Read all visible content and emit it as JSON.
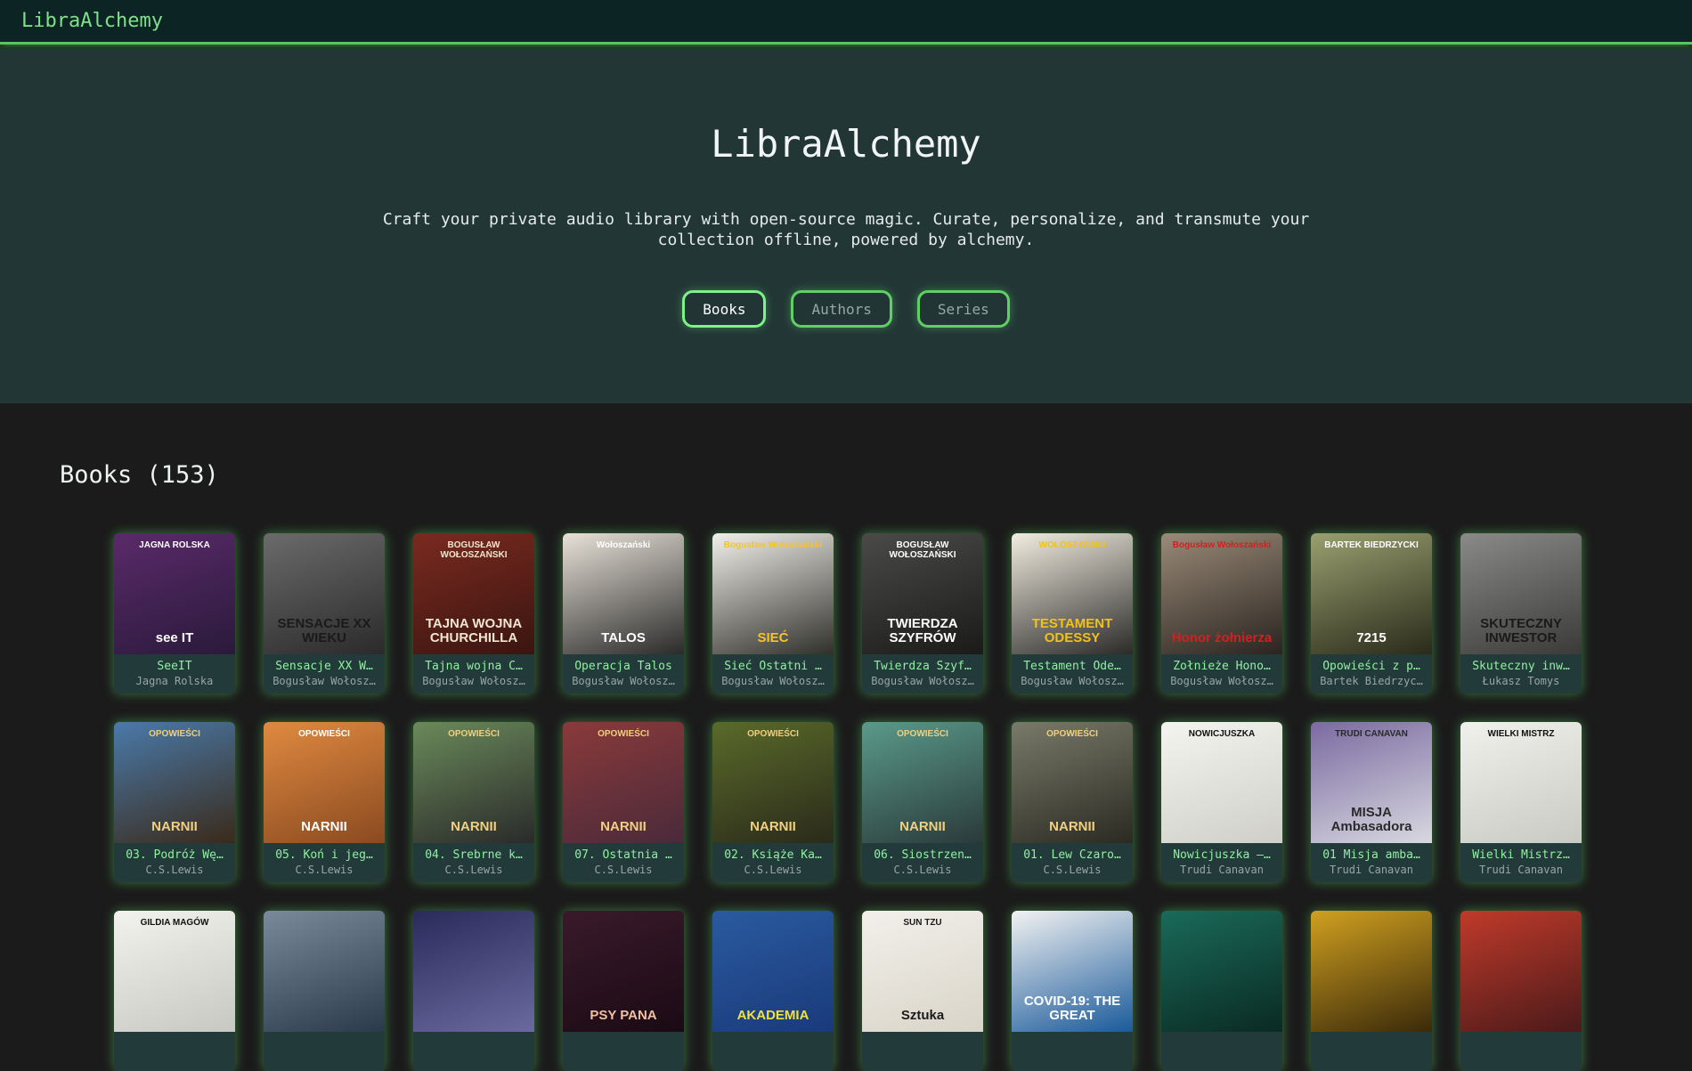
{
  "nav": {
    "brand": "LibraAlchemy"
  },
  "hero": {
    "title": "LibraAlchemy",
    "tagline": "Craft your private audio library with open-source magic. Curate, personalize, and transmute your collection offline, powered by alchemy.",
    "tabs": [
      {
        "label": "Books",
        "active": true
      },
      {
        "label": "Authors",
        "active": false
      },
      {
        "label": "Series",
        "active": false
      }
    ]
  },
  "books_section": {
    "heading": "Books (153)"
  },
  "books": [
    {
      "title": "SeeIT",
      "author": "Jagna Rolska",
      "cover_text": "see IT",
      "cover_author": "JAGNA ROLSKA",
      "cover_bg": "#5a2a6a",
      "cover_bg2": "#2a1a3a",
      "cover_fg": "#ffffff"
    },
    {
      "title": "Sensacje XX W…",
      "author": "Bogusław Wołosz…",
      "cover_text": "SENSACJE XX WIEKU",
      "cover_author": "",
      "cover_bg": "#6b6b6b",
      "cover_bg2": "#2a2a2a",
      "cover_fg": "#1a1a1a"
    },
    {
      "title": "Tajna wojna C…",
      "author": "Bogusław Wołosz…",
      "cover_text": "TAJNA WOJNA CHURCHILLA",
      "cover_author": "BOGUSŁAW WOŁOSZAŃSKI",
      "cover_bg": "#7a2a20",
      "cover_bg2": "#3a1510",
      "cover_fg": "#f0e6d0"
    },
    {
      "title": "Operacja Talos",
      "author": "Bogusław Wołosz…",
      "cover_text": "TALOS",
      "cover_author": "Wołoszański",
      "cover_bg": "#e8e2d8",
      "cover_bg2": "#2a2a2a",
      "cover_fg": "#ffffff"
    },
    {
      "title": "Sieć Ostatni …",
      "author": "Bogusław Wołosz…",
      "cover_text": "SIEĆ",
      "cover_author": "Bogusław Wołoszański",
      "cover_bg": "#f2f0ea",
      "cover_bg2": "#30302a",
      "cover_fg": "#f3c52a"
    },
    {
      "title": "Twierdza Szyf…",
      "author": "Bogusław Wołosz…",
      "cover_text": "TWIERDZA SZYFRÓW",
      "cover_author": "BOGUSŁAW WOŁOSZAŃSKI",
      "cover_bg": "#4a4a48",
      "cover_bg2": "#1a1a18",
      "cover_fg": "#ffffff"
    },
    {
      "title": "Testament Ode…",
      "author": "Bogusław Wołosz…",
      "cover_text": "TESTAMENT ODESSY",
      "cover_author": "WOŁOSZAŃSKI",
      "cover_bg": "#f2ede0",
      "cover_bg2": "#2a2a28",
      "cover_fg": "#f0c21a"
    },
    {
      "title": "Żołnieże Hono…",
      "author": "Bogusław Wołosz…",
      "cover_text": "Honor żołnierza",
      "cover_author": "Bogusław Wołoszański",
      "cover_bg": "#9a8a78",
      "cover_bg2": "#2a2420",
      "cover_fg": "#d22020"
    },
    {
      "title": "Opowieści z p…",
      "author": "Bartek Biedrzyc…",
      "cover_text": "7215",
      "cover_author": "BARTEK BIEDRZYCKI",
      "cover_bg": "#9aa070",
      "cover_bg2": "#2a2a1a",
      "cover_fg": "#ffffff"
    },
    {
      "title": "Skuteczny inw…",
      "author": "Łukasz Tomys",
      "cover_text": "SKUTECZNY INWESTOR",
      "cover_author": "",
      "cover_bg": "#8a8a88",
      "cover_bg2": "#3a3a38",
      "cover_fg": "#1a1a1a"
    },
    {
      "title": "03. Podróż Wę…",
      "author": "C.S.Lewis",
      "cover_text": "NARNII",
      "cover_author": "OPOWIEŚCI",
      "cover_bg": "#4a7aaa",
      "cover_bg2": "#3a2a1a",
      "cover_fg": "#f0d080"
    },
    {
      "title": "05. Koń i jeg…",
      "author": "C.S.Lewis",
      "cover_text": "NARNII",
      "cover_author": "OPOWIEŚCI",
      "cover_bg": "#e08a40",
      "cover_bg2": "#8a4a20",
      "cover_fg": "#ffffff"
    },
    {
      "title": "04. Srebrne k…",
      "author": "C.S.Lewis",
      "cover_text": "NARNII",
      "cover_author": "OPOWIEŚCI",
      "cover_bg": "#6a8a5a",
      "cover_bg2": "#2a2a2a",
      "cover_fg": "#f0d080"
    },
    {
      "title": "07. Ostatnia …",
      "author": "C.S.Lewis",
      "cover_text": "NARNII",
      "cover_author": "OPOWIEŚCI",
      "cover_bg": "#8a3a3a",
      "cover_bg2": "#4a2a3a",
      "cover_fg": "#f0d080"
    },
    {
      "title": "02. Książe Ka…",
      "author": "C.S.Lewis",
      "cover_text": "NARNII",
      "cover_author": "OPOWIEŚCI",
      "cover_bg": "#5a6a2a",
      "cover_bg2": "#2a2a1a",
      "cover_fg": "#f0d080"
    },
    {
      "title": "06. Siostrzen…",
      "author": "C.S.Lewis",
      "cover_text": "NARNII",
      "cover_author": "OPOWIEŚCI",
      "cover_bg": "#5a9a8a",
      "cover_bg2": "#2a3a3a",
      "cover_fg": "#f0d080"
    },
    {
      "title": "01. Lew Czaro…",
      "author": "C.S.Lewis",
      "cover_text": "NARNII",
      "cover_author": "OPOWIEŚCI",
      "cover_bg": "#7a7a6a",
      "cover_bg2": "#2a2a22",
      "cover_fg": "#f0d080"
    },
    {
      "title": "Nowicjuszka –…",
      "author": "Trudi Canavan",
      "cover_text": "",
      "cover_author": "NOWICJUSZKA",
      "cover_bg": "#f4f4f0",
      "cover_bg2": "#cfcfc8",
      "cover_fg": "#111111"
    },
    {
      "title": "01 Misja amba…",
      "author": "Trudi Canavan",
      "cover_text": "MISJA Ambasadora",
      "cover_author": "TRUDI CANAVAN",
      "cover_bg": "#7a6aa0",
      "cover_bg2": "#d8d8e0",
      "cover_fg": "#2a2a2a"
    },
    {
      "title": "Wielki Mistrz…",
      "author": "Trudi Canavan",
      "cover_text": "",
      "cover_author": "WIELKI MISTRZ",
      "cover_bg": "#f0f0ec",
      "cover_bg2": "#cacac4",
      "cover_fg": "#111111"
    },
    {
      "title": "",
      "author": "",
      "cover_text": "",
      "cover_author": "GILDIA MAGÓW",
      "cover_bg": "#f2f2ee",
      "cover_bg2": "#c8c8c2",
      "cover_fg": "#111111"
    },
    {
      "title": "",
      "author": "",
      "cover_text": "",
      "cover_author": "",
      "cover_bg": "#7a8a9a",
      "cover_bg2": "#2a3a4a",
      "cover_fg": "#ffffff"
    },
    {
      "title": "",
      "author": "",
      "cover_text": "",
      "cover_author": "",
      "cover_bg": "#2a2a5a",
      "cover_bg2": "#6a6aa0",
      "cover_fg": "#ffffff"
    },
    {
      "title": "",
      "author": "",
      "cover_text": "PSY PANA",
      "cover_author": "",
      "cover_bg": "#3a1a2a",
      "cover_bg2": "#1a0a14",
      "cover_fg": "#f0c0a0"
    },
    {
      "title": "",
      "author": "",
      "cover_text": "AKADEMIA",
      "cover_author": "",
      "cover_bg": "#2a5aa0",
      "cover_bg2": "#1a3a7a",
      "cover_fg": "#f0e040"
    },
    {
      "title": "",
      "author": "",
      "cover_text": "Sztuka",
      "cover_author": "SUN TZU",
      "cover_bg": "#f2f0ea",
      "cover_bg2": "#d8d4c8",
      "cover_fg": "#1a1a1a"
    },
    {
      "title": "",
      "author": "",
      "cover_text": "COVID-19: THE GREAT",
      "cover_author": "",
      "cover_bg": "#f2f2f2",
      "cover_bg2": "#1a5a9a",
      "cover_fg": "#ffffff"
    },
    {
      "title": "",
      "author": "",
      "cover_text": "",
      "cover_author": "",
      "cover_bg": "#1a6a5a",
      "cover_bg2": "#0a2a22",
      "cover_fg": "#ffffff"
    },
    {
      "title": "",
      "author": "",
      "cover_text": "",
      "cover_author": "",
      "cover_bg": "#d0a020",
      "cover_bg2": "#3a2a0a",
      "cover_fg": "#ffffff"
    },
    {
      "title": "",
      "author": "",
      "cover_text": "",
      "cover_author": "",
      "cover_bg": "#c03a2a",
      "cover_bg2": "#4a1a1a",
      "cover_fg": "#ffffff"
    }
  ]
}
